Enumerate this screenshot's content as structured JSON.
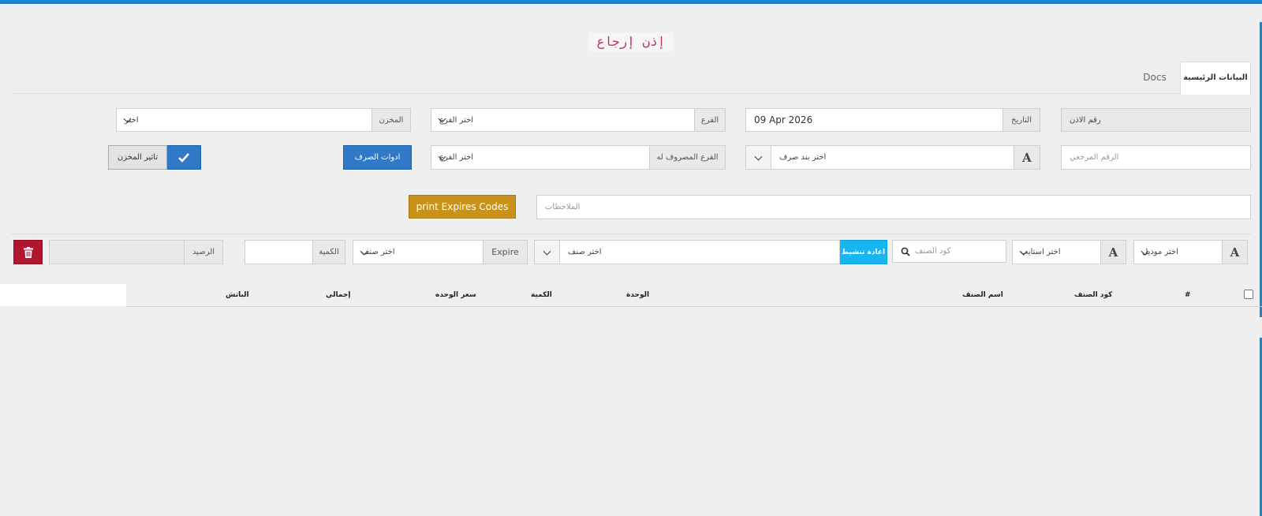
{
  "page": {
    "title": "إذن إرجاع"
  },
  "tabs": [
    {
      "label": "البيانات الرئيسية",
      "active": true
    },
    {
      "label": "Docs",
      "active": false
    }
  ],
  "row1": {
    "doc_number": {
      "label": "رقم الاذن",
      "value": ""
    },
    "date": {
      "label": "التاريخ",
      "value": "09 Apr 2026"
    },
    "branch": {
      "label": "الفرع",
      "value": "اختر الفرع"
    },
    "warehouse": {
      "label": "المخزن",
      "value": "اختر"
    }
  },
  "row2": {
    "reference": {
      "placeholder": "الرقم المرجعي"
    },
    "expense_item": {
      "value": "اختر بند صرف",
      "icon": "A"
    },
    "target_branch": {
      "label": "الفرع المصروف له",
      "value": "اختر الفرع"
    },
    "expense_tools_button": "ادوات الصرف",
    "warehouse_effect_button": "تاثير المخزن"
  },
  "row3": {
    "notes": {
      "placeholder": "الملاحظات"
    },
    "print_button": "print Expires Codes"
  },
  "row4": {
    "model": {
      "value": "اختر موديل",
      "icon": "A"
    },
    "style": {
      "value": "اختر استايب",
      "icon": "A"
    },
    "item_code": {
      "placeholder": "كود الصنف"
    },
    "activate_button": "اعادة تنشيط",
    "item": {
      "value": "اختر صنف"
    },
    "expire": {
      "label": "Expire",
      "value": "اختر صنف"
    },
    "quantity": {
      "label": "الكمية",
      "value": ""
    },
    "balance": {
      "label": "الرصيد",
      "value": ""
    }
  },
  "table": {
    "headers": [
      "#",
      "كود الصنف",
      "اسم الصنف",
      "الوحدة",
      "الكمية",
      "سعر الوحده",
      "إجمالي",
      "الباتش"
    ]
  },
  "colors": {
    "accent": "#1a83cc",
    "title": "#c0306a",
    "blue": "#3079c8",
    "gold": "#c8921c",
    "cyan": "#18b6f0",
    "red": "#b1152f"
  }
}
